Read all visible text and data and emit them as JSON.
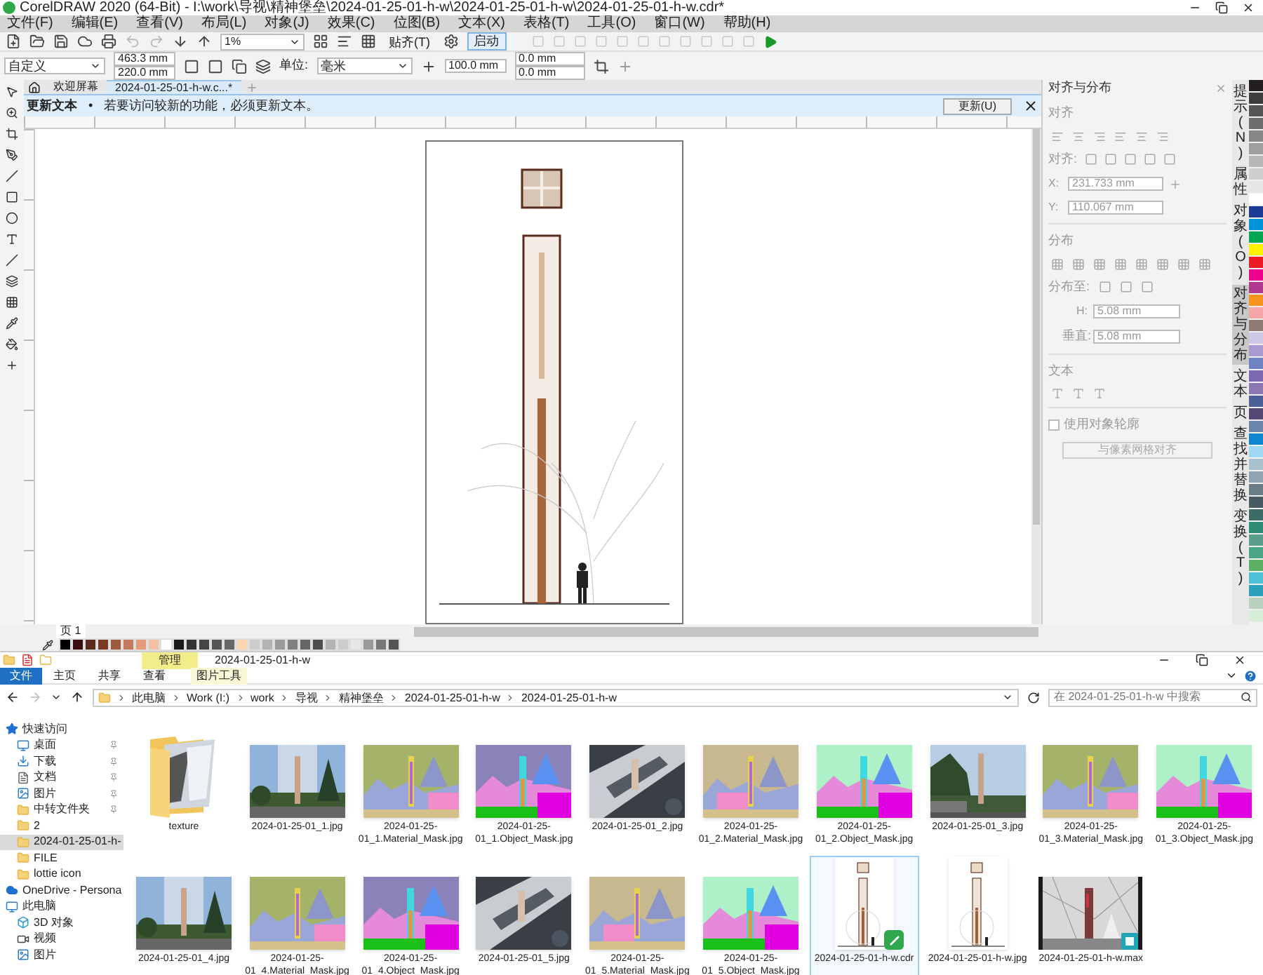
{
  "window": {
    "title": "CorelDRAW 2020 (64-Bit) - I:\\work\\导视\\精神堡垒\\2024-01-25-01-h-w\\2024-01-25-01-h-w\\2024-01-25-01-h-w.cdr*"
  },
  "menu": [
    "文件(F)",
    "编辑(E)",
    "查看(V)",
    "布局(L)",
    "对象(J)",
    "效果(C)",
    "位图(B)",
    "文本(X)",
    "表格(T)",
    "工具(O)",
    "窗口(W)",
    "帮助(H)"
  ],
  "toolbar": {
    "zoom": "1%",
    "snap": "贴齐(T)",
    "launch": "启动"
  },
  "property_bar": {
    "preset": "自定义",
    "width": "463.3 mm",
    "height": "220.0 mm",
    "units_label": "单位:",
    "units": "毫米",
    "nudge": "100.0 mm",
    "dup_x": "0.0 mm",
    "dup_y": "0.0 mm"
  },
  "doc_tabs": [
    {
      "label": "欢迎屏幕",
      "selected": false
    },
    {
      "label": "2024-01-25-01-h-w.c...*",
      "selected": true
    }
  ],
  "notice": {
    "title": "更新文本",
    "bullet": "•",
    "message": "若要访问较新的功能，必须更新文本。",
    "button": "更新(U)"
  },
  "docker": {
    "title": "对齐与分布",
    "align_section": "对齐",
    "align_label": "对齐:",
    "x_label": "X:",
    "x": "231.733 mm",
    "y_label": "Y:",
    "y": "110.067 mm",
    "distribute_section": "分布",
    "distribute_label": "分布至:",
    "h_label": "H:",
    "h": "5.08 mm",
    "v_label": "垂直:",
    "v": "5.08 mm",
    "text_section": "文本",
    "outline_checkbox": {
      "label": "使用对象轮廓",
      "checked": false
    },
    "grid_button": "与像素网格对齐"
  },
  "side_tabs": [
    {
      "label": "提示(N)",
      "selected": false
    },
    {
      "label": "属性",
      "selected": false
    },
    {
      "label": "对象(O)",
      "selected": false
    },
    {
      "label": "对齐与分布",
      "selected": true
    },
    {
      "label": "文本",
      "selected": false
    },
    {
      "label": "页",
      "selected": false
    },
    {
      "label": "查找并替换",
      "selected": false
    },
    {
      "label": "变换(T)",
      "selected": false
    }
  ],
  "page_nav": {
    "page": "页 1"
  },
  "explorer": {
    "title": "2024-01-25-01-h-w",
    "context_tab": "管理",
    "ribbon": [
      {
        "label": "文件",
        "kind": "file"
      },
      {
        "label": "主页",
        "kind": "tab"
      },
      {
        "label": "共享",
        "kind": "tab"
      },
      {
        "label": "查看",
        "kind": "tab"
      },
      {
        "label": "图片工具",
        "kind": "context"
      }
    ],
    "path": [
      "此电脑",
      "Work (I:)",
      "work",
      "导视",
      "精神堡垒",
      "2024-01-25-01-h-w",
      "2024-01-25-01-h-w"
    ],
    "search": {
      "placeholder": "在 2024-01-25-01-h-w 中搜索"
    },
    "nav": [
      {
        "label": "快速访问",
        "kind": "star",
        "pinned": false,
        "selected": false
      },
      {
        "label": "桌面",
        "kind": "desktop",
        "pinned": true,
        "selected": false
      },
      {
        "label": "下载",
        "kind": "download",
        "pinned": true,
        "selected": false
      },
      {
        "label": "文档",
        "kind": "document",
        "pinned": true,
        "selected": false
      },
      {
        "label": "图片",
        "kind": "picture",
        "pinned": true,
        "selected": false
      },
      {
        "label": "中转文件夹",
        "kind": "folder",
        "pinned": true,
        "selected": false
      },
      {
        "label": "2",
        "kind": "folder",
        "pinned": false,
        "selected": false
      },
      {
        "label": "2024-01-25-01-h-",
        "kind": "folder",
        "pinned": false,
        "selected": true
      },
      {
        "label": "FILE",
        "kind": "folder",
        "pinned": false,
        "selected": false
      },
      {
        "label": "lottie icon",
        "kind": "folder",
        "pinned": false,
        "selected": false
      },
      {
        "label": "OneDrive - Persona",
        "kind": "cloud",
        "pinned": false,
        "selected": false
      },
      {
        "label": "此电脑",
        "kind": "pc",
        "pinned": false,
        "selected": false
      },
      {
        "label": "3D 对象",
        "kind": "cube",
        "pinned": false,
        "selected": false
      },
      {
        "label": "视频",
        "kind": "video",
        "pinned": false,
        "selected": false
      },
      {
        "label": "图片",
        "kind": "picture",
        "pinned": false,
        "selected": false
      }
    ],
    "files": [
      {
        "name": "texture",
        "kind": "folder",
        "selected": false
      },
      {
        "name": "2024-01-25-01_1.jpg",
        "selected": false
      },
      {
        "name": "2024-01-25-01_1.Material_Mask.jpg",
        "kind": "material",
        "selected": false
      },
      {
        "name": "2024-01-25-01_1.Object_Mask.jpg",
        "kind": "object",
        "selected": false
      },
      {
        "name": "2024-01-25-01_2.jpg",
        "selected": false
      },
      {
        "name": "2024-01-25-01_2.Material_Mask.jpg",
        "kind": "material",
        "selected": false
      },
      {
        "name": "2024-01-25-01_2.Object_Mask.jpg",
        "kind": "object",
        "selected": false
      },
      {
        "name": "2024-01-25-01_3.jpg",
        "selected": false
      },
      {
        "name": "2024-01-25-01_3.Material_Mask.jpg",
        "kind": "material",
        "selected": false
      },
      {
        "name": "2024-01-25-01_3.Object_Mask.jpg",
        "kind": "object",
        "selected": false
      },
      {
        "name": "2024-01-25-01_4.jpg",
        "selected": false
      },
      {
        "name": "2024-01-25-01_4.Material_Mask.jpg",
        "kind": "material",
        "selected": false
      },
      {
        "name": "2024-01-25-01_4.Object_Mask.jpg",
        "kind": "object",
        "selected": false
      },
      {
        "name": "2024-01-25-01_5.jpg",
        "selected": false
      },
      {
        "name": "2024-01-25-01_5.Material_Mask.jpg",
        "kind": "material",
        "selected": false
      },
      {
        "name": "2024-01-25-01_5.Object_Mask.jpg",
        "kind": "object",
        "selected": false
      },
      {
        "name": "2024-01-25-01-h-w.cdr",
        "kind": "drawing",
        "selected": true
      },
      {
        "name": "2024-01-25-01-h-w.jpg",
        "kind": "sheet",
        "selected": false
      },
      {
        "name": "2024-01-25-01-h-w.max",
        "kind": "render",
        "selected": false
      }
    ]
  }
}
